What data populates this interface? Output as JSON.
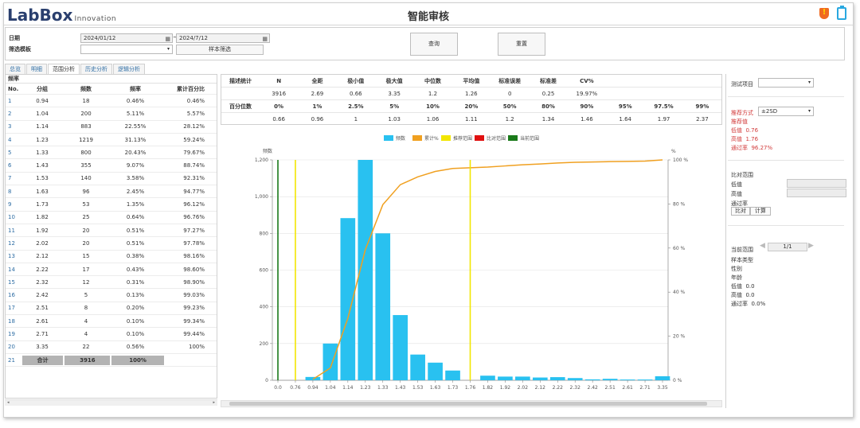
{
  "app": {
    "logo_main": "LabBox",
    "logo_sub": "Innovation",
    "title": "智能审核"
  },
  "filters": {
    "date_label": "日期",
    "template_label": "筛选模板",
    "date_from": "2024/01/12",
    "date_sep": "~",
    "date_to": "2024/7/12",
    "template_value": "",
    "sample_filter_button": "样本筛选",
    "query_button": "查询",
    "reset_button": "重置"
  },
  "tabs": [
    "总览",
    "明细",
    "范围分析",
    "历史分析",
    "逻辑分析"
  ],
  "active_tab": "范围分析",
  "freq_table": {
    "title": "频率",
    "headers": [
      "No.",
      "分组",
      "频数",
      "频率",
      "累计百分比"
    ],
    "rows": [
      [
        "1",
        "0.94",
        "18",
        "0.46%",
        "0.46%"
      ],
      [
        "2",
        "1.04",
        "200",
        "5.11%",
        "5.57%"
      ],
      [
        "3",
        "1.14",
        "883",
        "22.55%",
        "28.12%"
      ],
      [
        "4",
        "1.23",
        "1219",
        "31.13%",
        "59.24%"
      ],
      [
        "5",
        "1.33",
        "800",
        "20.43%",
        "79.67%"
      ],
      [
        "6",
        "1.43",
        "355",
        "9.07%",
        "88.74%"
      ],
      [
        "7",
        "1.53",
        "140",
        "3.58%",
        "92.31%"
      ],
      [
        "8",
        "1.63",
        "96",
        "2.45%",
        "94.77%"
      ],
      [
        "9",
        "1.73",
        "53",
        "1.35%",
        "96.12%"
      ],
      [
        "10",
        "1.82",
        "25",
        "0.64%",
        "96.76%"
      ],
      [
        "11",
        "1.92",
        "20",
        "0.51%",
        "97.27%"
      ],
      [
        "12",
        "2.02",
        "20",
        "0.51%",
        "97.78%"
      ],
      [
        "13",
        "2.12",
        "15",
        "0.38%",
        "98.16%"
      ],
      [
        "14",
        "2.22",
        "17",
        "0.43%",
        "98.60%"
      ],
      [
        "15",
        "2.32",
        "12",
        "0.31%",
        "98.90%"
      ],
      [
        "16",
        "2.42",
        "5",
        "0.13%",
        "99.03%"
      ],
      [
        "17",
        "2.51",
        "8",
        "0.20%",
        "99.23%"
      ],
      [
        "18",
        "2.61",
        "4",
        "0.10%",
        "99.34%"
      ],
      [
        "19",
        "2.71",
        "4",
        "0.10%",
        "99.44%"
      ],
      [
        "20",
        "3.35",
        "22",
        "0.56%",
        "100%"
      ]
    ],
    "total_row": [
      "21",
      "合计",
      "3916",
      "100%",
      ""
    ]
  },
  "stats_table": {
    "row1": [
      "描述统计",
      "N",
      "全距",
      "极小值",
      "极大值",
      "中位数",
      "平均值",
      "标准误差",
      "标准差",
      "CV%",
      "",
      "",
      ""
    ],
    "row2": [
      "",
      "3916",
      "2.69",
      "0.66",
      "3.35",
      "1.2",
      "1.26",
      "0",
      "0.25",
      "19.97%",
      "",
      "",
      ""
    ],
    "row3": [
      "百分位数",
      "0%",
      "1%",
      "2.5%",
      "5%",
      "10%",
      "20%",
      "50%",
      "80%",
      "90%",
      "95%",
      "97.5%",
      "99%"
    ],
    "row4": [
      "",
      "0.66",
      "0.96",
      "1",
      "1.03",
      "1.06",
      "1.11",
      "1.2",
      "1.34",
      "1.46",
      "1.64",
      "1.97",
      "2.37"
    ]
  },
  "right_panel": {
    "test_item_label": "测试项目",
    "test_item_value": "",
    "recommend_method_label": "推荐方式",
    "recommend_method_value": "±2SD",
    "recommend_value_label": "推荐值",
    "low_label": "低值",
    "low_value": "0.76",
    "high_label": "高值",
    "high_value": "1.76",
    "pass_label": "通过率",
    "pass_value": "96.27%",
    "compare_range_label": "比对范围",
    "compare_low_label": "低值",
    "compare_high_label": "高值",
    "compare_pass_label": "通过率",
    "compare_button": "比对",
    "calc_button": "计算",
    "current_range_label": "当前范围",
    "pager": "1/1",
    "sample_type_label": "样本类型",
    "gender_label": "性别",
    "age_label": "年龄",
    "cur_low_label": "低值",
    "cur_low_value": "0.0",
    "cur_high_label": "高值",
    "cur_high_value": "0.0",
    "cur_pass_label": "通过率",
    "cur_pass_value": "0.0%"
  },
  "colors": {
    "bar": "#29c1f0",
    "cumulative": "#f0a020",
    "recommend": "#f2e600",
    "compare": "#e01010",
    "current": "#1a7a1a"
  },
  "chart_data": {
    "type": "bar",
    "legend": [
      "频数",
      "累计%",
      "推荐范围",
      "比对范围",
      "当前范围"
    ],
    "legend_position": "top-center",
    "ylabel_left": "频数",
    "ylabel_right": "%",
    "y_ticks_left": [
      "0",
      "200",
      "400",
      "600",
      "800",
      "1,000",
      "1,200"
    ],
    "y_ticks_right": [
      "0 %",
      "20 %",
      "40 %",
      "60 %",
      "80 %",
      "100 %"
    ],
    "ylim_left": [
      0,
      1200
    ],
    "ylim_right": [
      0,
      100
    ],
    "x_ticks": [
      "0.0",
      "0.76",
      "0.94",
      "1.04",
      "1.14",
      "1.23",
      "1.33",
      "1.43",
      "1.53",
      "1.63",
      "1.73",
      "1.76",
      "1.82",
      "1.92",
      "2.02",
      "2.12",
      "2.22",
      "2.32",
      "2.42",
      "2.51",
      "2.61",
      "2.71",
      "3.35"
    ],
    "categories": [
      "0.94",
      "1.04",
      "1.14",
      "1.23",
      "1.33",
      "1.43",
      "1.53",
      "1.63",
      "1.73",
      "1.82",
      "1.92",
      "2.02",
      "2.12",
      "2.22",
      "2.32",
      "2.42",
      "2.51",
      "2.61",
      "2.71",
      "3.35"
    ],
    "series": [
      {
        "name": "频数",
        "type": "bar",
        "values": [
          18,
          200,
          883,
          1219,
          800,
          355,
          140,
          96,
          53,
          25,
          20,
          20,
          15,
          17,
          12,
          5,
          8,
          4,
          4,
          22
        ]
      },
      {
        "name": "累计%",
        "type": "line",
        "values": [
          0.46,
          5.57,
          28.12,
          59.24,
          79.67,
          88.74,
          92.31,
          94.77,
          96.12,
          96.76,
          97.27,
          97.78,
          98.16,
          98.6,
          98.9,
          99.03,
          99.23,
          99.34,
          99.44,
          100
        ]
      }
    ],
    "vertical_lines": [
      {
        "name": "推荐范围",
        "x": "0.76"
      },
      {
        "name": "推荐范围",
        "x": "1.76"
      },
      {
        "name": "当前范围",
        "x": "0.0"
      }
    ],
    "grid": true
  }
}
